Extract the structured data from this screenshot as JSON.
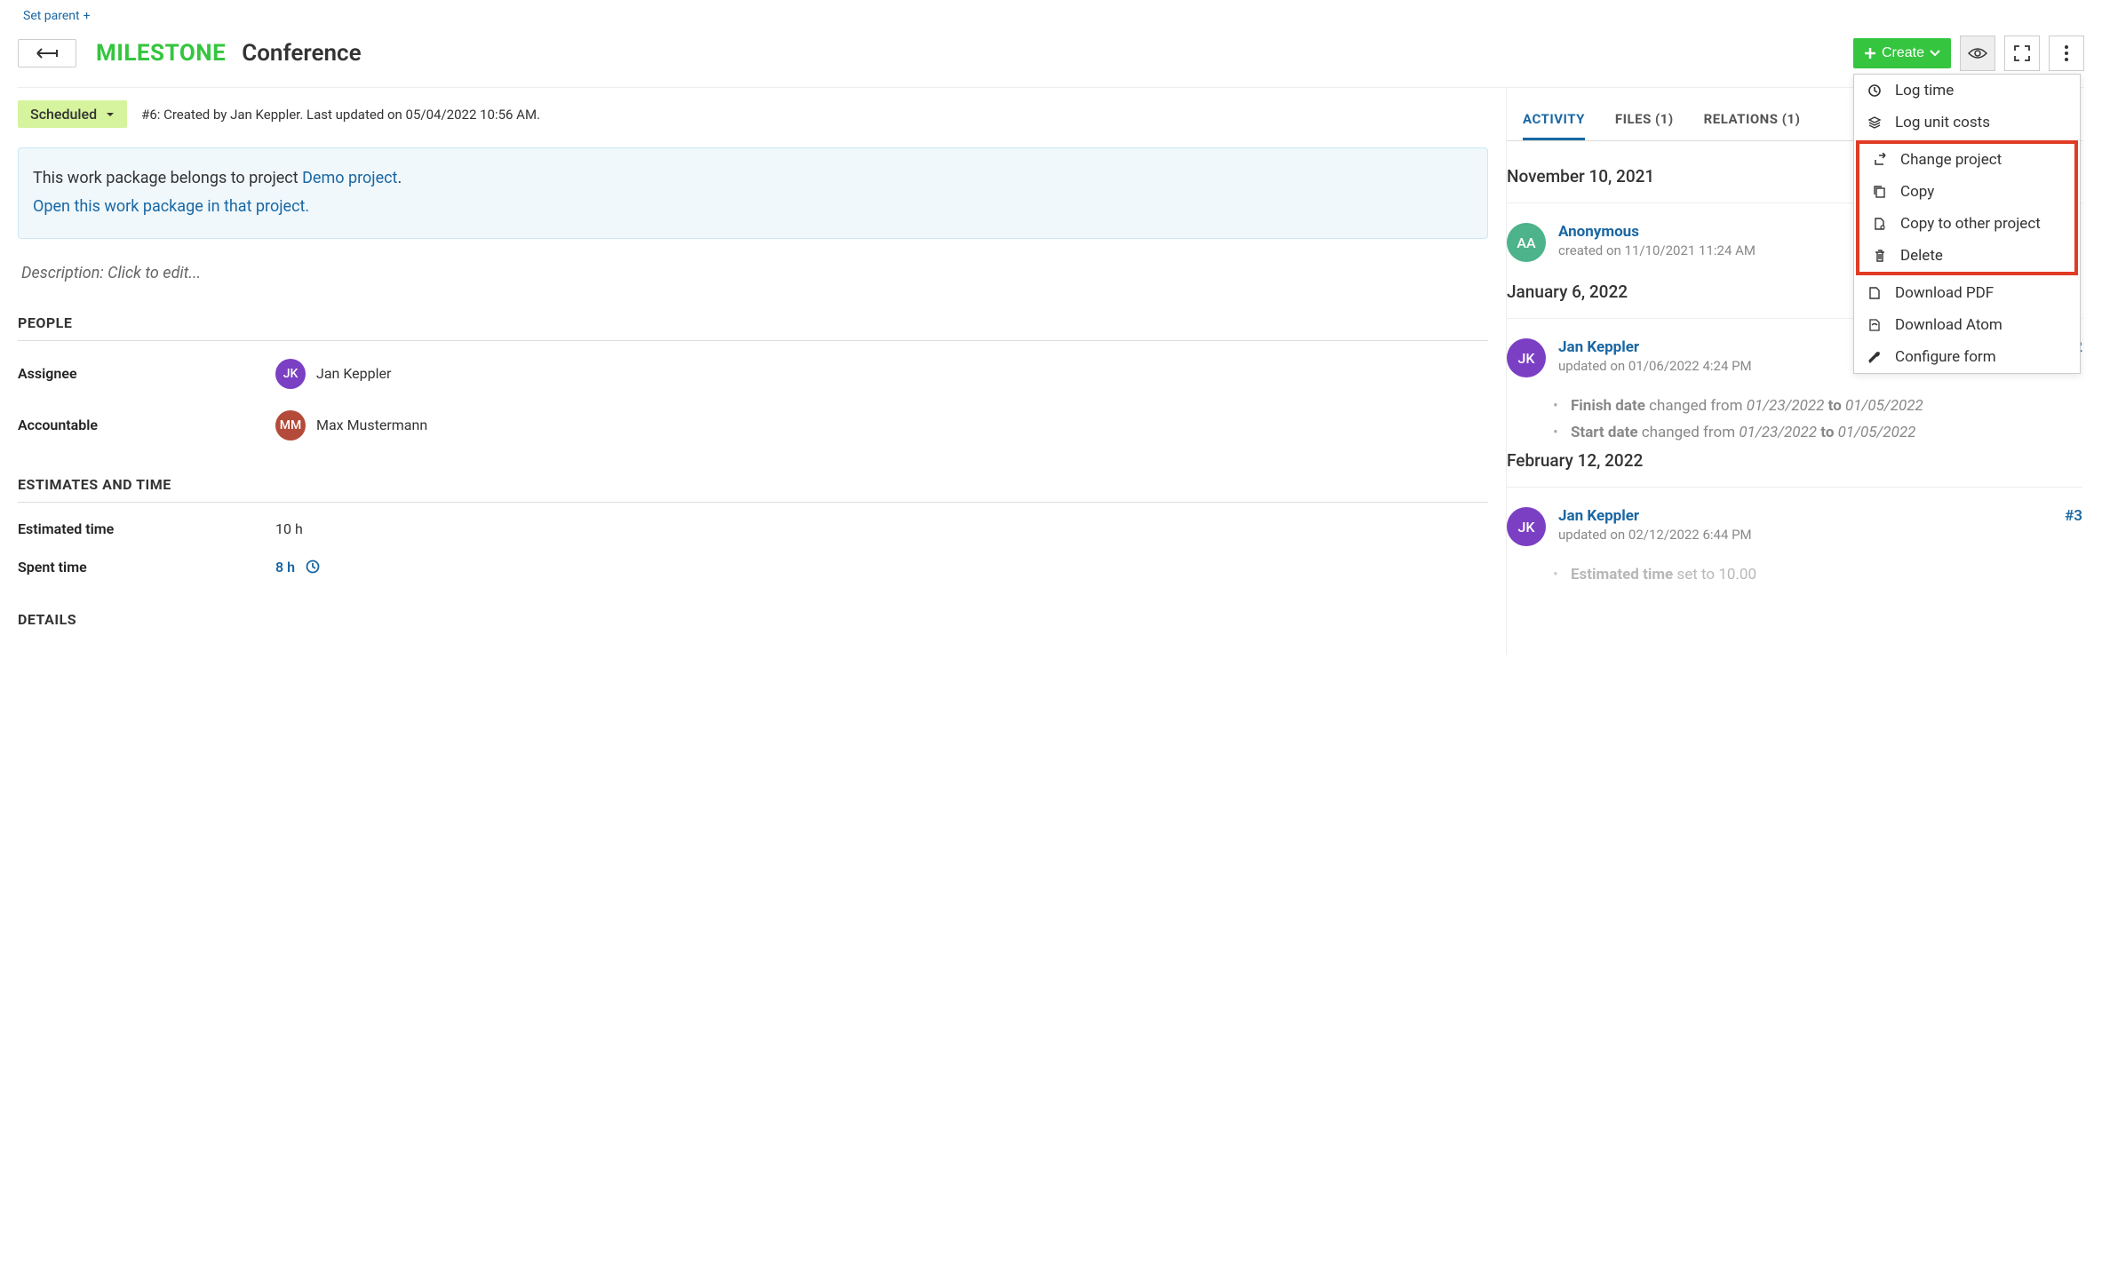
{
  "set_parent": "Set parent",
  "type": "MILESTONE",
  "title": "Conference",
  "create_btn": "Create",
  "status": "Scheduled",
  "wp_meta": "#6: Created by Jan Keppler. Last updated on 05/04/2022 10:56 AM.",
  "info_text": "This work package belongs to project ",
  "info_project": "Demo project",
  "info_open": "Open this work package in that project.",
  "description_placeholder": "Description: Click to edit...",
  "sections": {
    "people": "PEOPLE",
    "estimates": "ESTIMATES AND TIME",
    "details": "DETAILS"
  },
  "fields": {
    "assignee": {
      "label": "Assignee",
      "initials": "JK",
      "name": "Jan Keppler"
    },
    "accountable": {
      "label": "Accountable",
      "initials": "MM",
      "name": "Max Mustermann"
    },
    "estimated": {
      "label": "Estimated time",
      "value": "10 h"
    },
    "spent": {
      "label": "Spent time",
      "value": "8 h"
    }
  },
  "tabs": {
    "activity": "ACTIVITY",
    "files": "FILES (1)",
    "relations": "RELATIONS (1)"
  },
  "activity": {
    "group1": "November 10, 2021",
    "entry1": {
      "initials": "AA",
      "user": "Anonymous",
      "meta": "created on 11/10/2021 11:24 AM"
    },
    "group2": "January 6, 2022",
    "entry2": {
      "initials": "JK",
      "user": "Jan Keppler",
      "num": "#2",
      "meta": "updated on 01/06/2022 4:24 PM",
      "c1_field": "Finish date",
      "c1_text": " changed from ",
      "c1_from": "01/23/2022",
      "c1_to_lbl": " to ",
      "c1_to": "01/05/2022",
      "c2_field": "Start date",
      "c2_from": "01/23/2022",
      "c2_to": "01/05/2022"
    },
    "group3": "February 12, 2022",
    "entry3": {
      "initials": "JK",
      "user": "Jan Keppler",
      "num": "#3",
      "meta": "updated on 02/12/2022 6:44 PM",
      "c1_field": "Estimated time",
      "c1_text": " set to 10.00"
    }
  },
  "menu": {
    "log_time": "Log time",
    "log_unit_costs": "Log unit costs",
    "change_project": "Change project",
    "copy": "Copy",
    "copy_other": "Copy to other project",
    "delete": "Delete",
    "download_pdf": "Download PDF",
    "download_atom": "Download Atom",
    "configure_form": "Configure form"
  }
}
